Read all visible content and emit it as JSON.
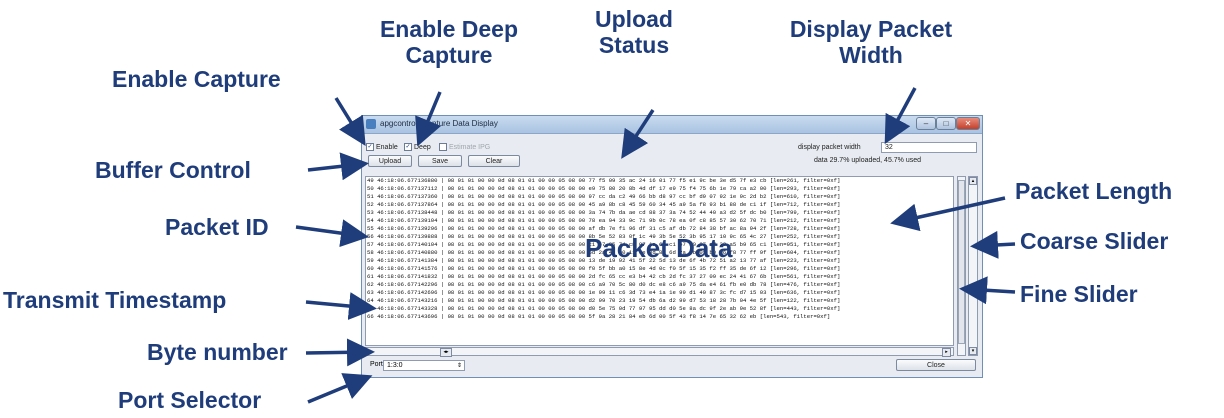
{
  "window": {
    "title": "apgcontrol: Capture Data Display",
    "controls": {
      "minimize": "–",
      "maximize": "□",
      "close": "✕"
    }
  },
  "capture": {
    "enable_label": "Enable",
    "enable_checked": true,
    "deep_label": "Deep",
    "deep_checked": true,
    "estimate_ipg_label": "Estimate IPG",
    "estimate_ipg_enabled": false
  },
  "buttons": {
    "upload": "Upload",
    "save": "Save",
    "clear": "Clear",
    "close": "Close"
  },
  "display_width": {
    "label": "display packet width",
    "value": "32"
  },
  "upload_status": "data 29.7% uploaded, 45.7% used",
  "port": {
    "label": "Port",
    "value": "1:3:0"
  },
  "packet_rows": [
    "49 46:18:06.677136880 | 08 01 01 00 00 0d 08 01 01 00 00 05 08 00 77 f5 09 35 ac 24 16 01 77 f5 e1 9c be 3e d5 7f e3 cb [len=261, filter=0xf]",
    "50 46:18:06.677137112 | 08 01 01 00 00 0d 08 01 01 00 00 05 08 00 e9 75 80 20 8b 4d df 17 e9 75 f4 75 6b 1e 79 ca a2 00 [len=293, filter=0xf]",
    "51 46:18:06.677137360 | 08 01 01 00 00 0d 08 01 01 00 00 05 08 00 97 cc da c2 49 66 bb d8 97 cc bf d9 07 92 1e 9c 2d b2 [len=610, filter=0xf]",
    "52 46:18:06.677137864 | 08 01 01 00 00 0d 08 01 01 00 00 05 08 00 45 a9 8b c8 45 59 60 34 45 a9 5a f8 93 b1 88 de c1 1f [len=712, filter=0xf]",
    "53 46:18:06.677138448 | 08 01 01 00 00 0d 08 01 01 00 00 05 08 00 3a 74 7b da ae cd 88 37 3a 74 52 44 40 a3 d2 5f dc b0 [len=799, filter=0xf]",
    "54 46:18:06.677139104 | 08 01 01 00 00 0d 08 01 01 00 00 05 08 00 78 ea 94 33 9c 71 9b 0c 78 ea 0f c8 85 57 30 62 70 71 [len=212, filter=0xf]",
    "55 46:18:06.677139296 | 08 01 01 00 00 0d 08 01 01 00 00 05 08 00 af db 7e f1 96 df 31 c5 af db 72 84 38 bf ac 8a 94 2f [len=728, filter=0xf]",
    "56 46:18:06.677139888 | 08 01 01 00 00 0d 08 01 01 00 00 05 08 00 8b 5e 52 83 0f 1c 49 3b 5e 52 3b 95 17 10 9c 65 4c 27 [len=252, filter=0xf]",
    "57 46:18:06.677140104 | 08 01 01 00 00 0d 08 01 01 00 00 05 08 00 c1 47 35 74 c8 07 1a 6d c1 47 d0 97 ef 38 a5 b9 65 c1 [len=951, filter=0xf]",
    "58 46:18:06.677140880 | 08 01 01 00 00 0d 08 01 01 00 00 05 08 00 6d 2a 4f 90 11 ce 3d 82 6d 2a 0b 0f b0 a6 f8 77 ff 9f [len=604, filter=0xf]",
    "59 46:18:06.677141384 | 08 01 01 00 00 0d 08 01 01 00 00 05 08 00 13 de 19 92 41 5f 22 5d 13 de 6f 4b 72 51 a2 13 77 af [len=223, filter=0xf]",
    "60 46:18:06.677141576 | 08 01 01 00 00 0d 08 01 01 00 00 05 08 00 f0 5f bb a0 15 8e 4d 0c f0 5f 15 35 f2 ff 35 de 6f 12 [len=296, filter=0xf]",
    "61 46:18:06.677141832 | 08 01 01 00 00 0d 08 01 01 00 00 05 08 00 2d fc 65 cc e3 b4 42 cb 2d fc 37 27 09 ec 24 41 67 6b [len=561, filter=0xf]",
    "62 46:18:06.677142296 | 08 01 01 00 00 0d 08 01 01 00 00 05 08 00 c6 a9 70 5c 80 d0 dc e8 c6 a9 75 da e4 61 fb e0 db 78 [len=476, filter=0xf]",
    "63 46:18:06.677142696 | 08 01 01 00 00 0d 08 01 01 00 00 05 08 00 1e 99 11 c6 3d 73 e4 1a 1e 99 d1 40 87 3c fc d7 15 03 [len=636, filter=0xf]",
    "64 46:18:06.677143216 | 08 01 01 00 00 0d 08 01 01 00 00 05 08 00 d2 99 70 23 19 54 db 6a d2 99 d7 53 18 28 7b 04 4e 5f [len=122, filter=0xf]",
    "65 46:18:06.677143328 | 08 01 01 00 00 0d 08 01 01 00 00 05 08 00 d0 5e 75 0d 77 97 95 dd d0 5e 8a dc 9f 2e ab 9e 52 8f [len=443, filter=0xf]",
    "66 46:18:06.677143696 | 08 01 01 00 00 0d 08 01 01 00 00 05 08 00 5f 9a 28 21 84 eb 6d 00 5f 43 f8 14 7e 65 32 62 eb [len=543, filter=0xf]"
  ],
  "annotations": {
    "enable_capture": "Enable Capture",
    "enable_deep_capture": [
      "Enable Deep",
      "Capture"
    ],
    "upload_status": [
      "Upload",
      "Status"
    ],
    "display_packet_width": [
      "Display Packet",
      "Width"
    ],
    "buffer_control": "Buffer Control",
    "packet_id": "Packet ID",
    "transmit_timestamp": "Transmit Timestamp",
    "byte_number": "Byte number",
    "port_selector": "Port Selector",
    "packet_data": "Packet Data",
    "packet_length": "Packet Length",
    "coarse_slider": "Coarse Slider",
    "fine_slider": "Fine Slider"
  },
  "colors": {
    "annotation": "#1f3d7a",
    "window_border": "#6f8fb5",
    "window_bg": "#e8ecf2"
  },
  "icons": [
    "window-app-icon",
    "minimize-icon",
    "maximize-icon",
    "close-icon",
    "dropdown-arrow-icon",
    "scroll-left-icon",
    "scroll-right-icon",
    "scroll-up-icon",
    "scroll-down-icon"
  ]
}
